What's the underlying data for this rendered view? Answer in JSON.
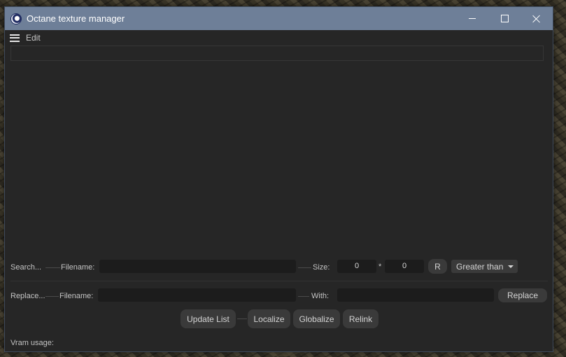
{
  "window": {
    "title": "Octane texture manager",
    "title_bar_color": "#6e7f98",
    "icons": [
      "cinema4d-app-icon",
      "minimize-icon",
      "maximize-icon",
      "close-icon"
    ]
  },
  "menu": {
    "items": [
      "Edit"
    ]
  },
  "search": {
    "label": "Search...",
    "filename_label": "Filename:",
    "filename_value": "",
    "size_label": "Size:",
    "width_value": "0",
    "times_symbol": "*",
    "height_value": "0",
    "reset_button": "R",
    "comparison": "Greater than"
  },
  "replace": {
    "label": "Replace...",
    "filename_label": "Filename:",
    "filename_value": "",
    "with_label": "With:",
    "with_value": "",
    "replace_button": "Replace"
  },
  "actions": {
    "update_list": "Update List",
    "localize": "Localize",
    "globalize": "Globalize",
    "relink": "Relink"
  },
  "status": {
    "vram_label": "Vram usage:"
  }
}
